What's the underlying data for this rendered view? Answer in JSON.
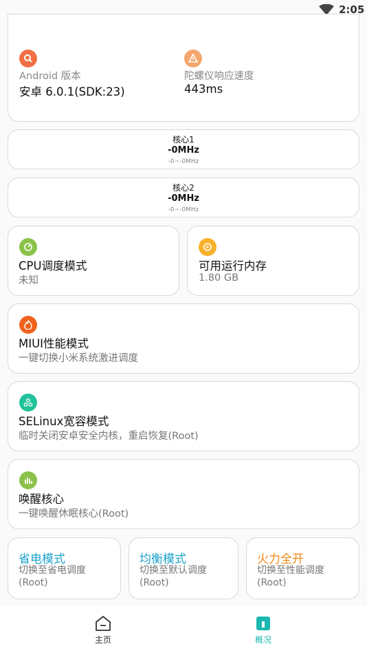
{
  "status_bar": {
    "time": "2:05"
  },
  "info_card": {
    "android": {
      "label": "Android 版本",
      "value": "安卓 6.0.1(SDK:23)"
    },
    "gyro": {
      "label": "陀螺仪响应速度",
      "value": "443ms"
    }
  },
  "cores": [
    {
      "name": "核心1",
      "freq": "-0MHz",
      "range": "-0~-0MHz"
    },
    {
      "name": "核心2",
      "freq": "-0MHz",
      "range": "-0~-0MHz"
    }
  ],
  "cpu_governor": {
    "title": "CPU调度模式",
    "value": "未知"
  },
  "memory": {
    "title": "可用运行内存",
    "value": "1.80 GB"
  },
  "miui": {
    "title": "MIUI性能模式",
    "desc": "一键切换小米系统激进调度"
  },
  "selinux": {
    "title": "SELinux宽容模式",
    "desc": "临时关闭安卓安全内核，重启恢复(Root)"
  },
  "wake": {
    "title": "唤醒核心",
    "desc": "一键唤醒休眠核心(Root)"
  },
  "modes": [
    {
      "title": "省电模式",
      "desc": "切换至省电调度(Root)",
      "color": "#1ba2c9"
    },
    {
      "title": "均衡模式",
      "desc": "切换至默认调度(Root)",
      "color": "#1ba2c9"
    },
    {
      "title": "火力全开",
      "desc": "切换至性能调度(Root)",
      "color": "#f08a16"
    }
  ],
  "nav": {
    "home": "主页",
    "overview": "概况",
    "active_color": "#1bb8b0"
  },
  "colors": {
    "android_icon": "#f26f45",
    "gyro_icon": "#f5a66d",
    "cpu_icon": "#8bc34a",
    "mem_icon": "#f7b12b",
    "miui_icon": "#f0621c",
    "selinux_icon": "#21c29a",
    "wake_icon": "#8bc34a"
  }
}
